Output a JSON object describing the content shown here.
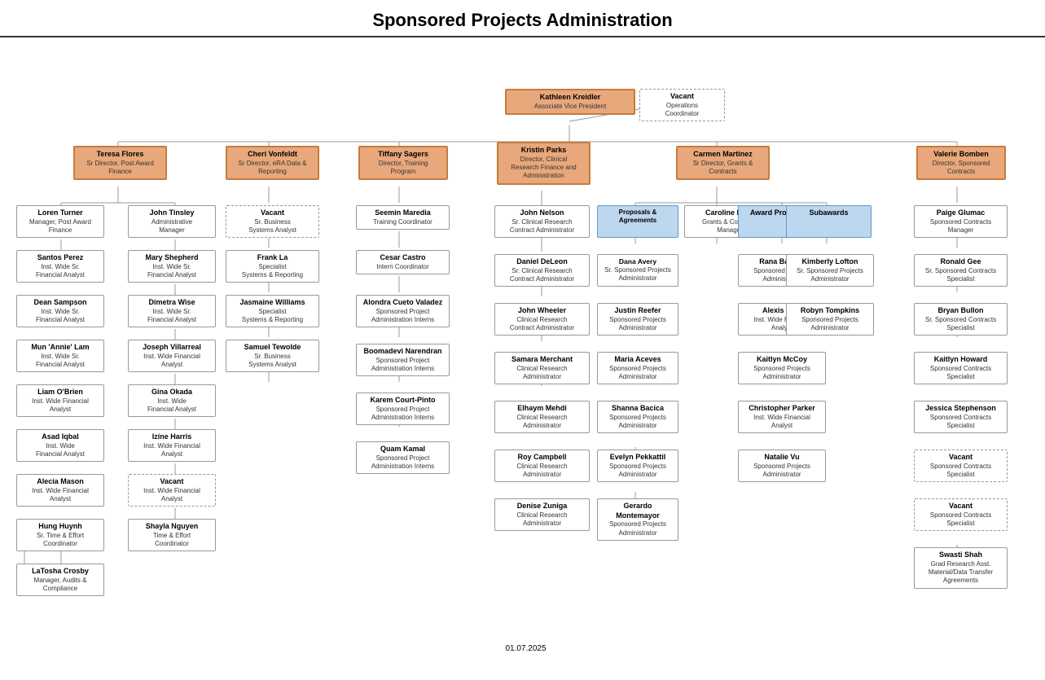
{
  "title": "Sponsored Projects Administration",
  "footer": "01.07.2025",
  "boxes": {
    "kathleen": {
      "name": "Kathleen Kreidler",
      "title": "Associate Vice President"
    },
    "vacant_ops": {
      "name": "Vacant",
      "title": "Operations\nCoordinator"
    },
    "teresa": {
      "name": "Teresa Flores",
      "title": "Sr Director, Post Award\nFinance"
    },
    "cheri": {
      "name": "Cheri Vonfeldt",
      "title": "Sr Director, eRA Data &\nReporting"
    },
    "tiffany": {
      "name": "Tiffany Sagers",
      "title": "Director, Training\nProgram"
    },
    "kristin": {
      "name": "Kristin Parks",
      "title": "Director, Clinical\nResearch Finance and\nAdministration"
    },
    "carmen": {
      "name": "Carmen Martinez",
      "title": "Sr Director, Grants &\nContracts"
    },
    "valerie": {
      "name": "Valerie Bomben",
      "title": "Director, Sponsored\nContracts"
    },
    "loren": {
      "name": "Loren Turner",
      "title": "Manager, Post Award\nFinance"
    },
    "john_t": {
      "name": "John Tinsley",
      "title": "Administrative\nManager"
    },
    "vacant_sr": {
      "name": "Vacant",
      "title": "Sr. Business\nSystems Analyst"
    },
    "frank": {
      "name": "Frank La",
      "title": "Specialist\nSystems & Reporting"
    },
    "jasmaine": {
      "name": "Jasmaine Williams",
      "title": "Specialist\nSystems & Reporting"
    },
    "samuel": {
      "name": "Samuel Tewolde",
      "title": "Sr. Business\nSystems Analyst"
    },
    "seemin": {
      "name": "Seemin Maredia",
      "title": "Training Coordinator"
    },
    "cesar": {
      "name": "Cesar Castro",
      "title": "Intern Coordinator"
    },
    "alondra": {
      "name": "Alondra Cueto Valadez",
      "title": "Sponsored Project\nAdministration Interns"
    },
    "boomadevi": {
      "name": "Boomadevi Narendran",
      "title": "Sponsored Project\nAdministration Interns"
    },
    "karem": {
      "name": "Karem Court-Pinto",
      "title": "Sponsored Project\nAdministration Interns"
    },
    "quam": {
      "name": "Quam Kamal",
      "title": "Sponsored Project\nAdministration Interns"
    },
    "john_n": {
      "name": "John Nelson",
      "title": "Sr. Clinical Research\nContract Administrator"
    },
    "daniel": {
      "name": "Daniel DeLeon",
      "title": "Sr. Clinical Research\nContract Administrator"
    },
    "john_w": {
      "name": "John Wheeler",
      "title": "Clinical Research\nContract Administrator"
    },
    "samara": {
      "name": "Samara Merchant",
      "title": "Clinical Research\nAdministrator"
    },
    "elhaym": {
      "name": "Elhaym Mehdi",
      "title": "Clinical Research\nAdministrator"
    },
    "roy": {
      "name": "Roy Campbell",
      "title": "Clinical Research\nAdministrator"
    },
    "denise": {
      "name": "Denise Zuniga",
      "title": "Clinical Research\nAdministrator"
    },
    "proposals": {
      "name": "Proposals &\nAgreements",
      "title": ""
    },
    "award_processing": {
      "name": "Award Processing",
      "title": ""
    },
    "subawards": {
      "name": "Subawards",
      "title": ""
    },
    "caroline": {
      "name": "Caroline Dietz",
      "title": "Grants & Contracts\nManager"
    },
    "dana_avery": {
      "name": "Dana Avery",
      "title": "Sr. Sponsored Projects\nAdministrator"
    },
    "justin": {
      "name": "Justin Reefer",
      "title": "Sponsored Projects\nAdministrator"
    },
    "maria": {
      "name": "Maria Aceves",
      "title": "Sponsored Projects\nAdministrator"
    },
    "shanna": {
      "name": "Shanna Bacica",
      "title": "Sponsored Projects\nAdministrator"
    },
    "evelyn_p": {
      "name": "Evelyn Pekkattil",
      "title": "Sponsored Projects\nAdministrator"
    },
    "gerardo": {
      "name": "Gerardo Montemayor",
      "title": "Sponsored Projects\nAdministrator"
    },
    "dana_spa": {
      "name": "Dana",
      "title": "Sponsored Projects\nAdministrator"
    },
    "rana": {
      "name": "Rana Banton",
      "title": "Sponsored Projects\nAdministrator"
    },
    "alexis": {
      "name": "Alexis Vara",
      "title": "Inst. Wide Financial\nAnalyst"
    },
    "kaitlyn_m": {
      "name": "Kaitlyn McCoy",
      "title": "Sponsored Projects\nAdministrator"
    },
    "christopher": {
      "name": "Christopher Parker",
      "title": "Inst. Wide Financial\nAnalyst"
    },
    "natalie": {
      "name": "Natalie Vu",
      "title": "Sponsored Projects\nAdministrator"
    },
    "kimberly": {
      "name": "Kimberly Lofton",
      "title": "Sr. Sponsored Projects\nAdministrator"
    },
    "robyn": {
      "name": "Robyn Tompkins",
      "title": "Sponsored Projects\nAdministrator"
    },
    "evelyn_spa": {
      "name": "Evelyn",
      "title": "Sponsored Projects\nAdministrator"
    },
    "paige": {
      "name": "Paige Glumac",
      "title": "Sponsored Contracts\nManager"
    },
    "ronald": {
      "name": "Ronald Gee",
      "title": "Sr. Sponsored Contracts\nSpecialist"
    },
    "bryan": {
      "name": "Bryan Bullon",
      "title": "Sr. Sponsored Contracts\nSpecialist"
    },
    "kaitlyn_h": {
      "name": "Kaitlyn Howard",
      "title": "Sponsored Contracts\nSpecialist"
    },
    "jessica": {
      "name": "Jessica Stephenson",
      "title": "Sponsored Contracts\nSpecialist"
    },
    "vacant_scs1": {
      "name": "Vacant",
      "title": "Sponsored Contracts\nSpecialist"
    },
    "vacant_scs2": {
      "name": "Vacant",
      "title": "Sponsored Contracts\nSpecialist"
    },
    "swasti": {
      "name": "Swasti Shah",
      "title": "Grad Research Asst.\nMaterial/Data Transfer\nAgreements"
    },
    "santos": {
      "name": "Santos Perez",
      "title": "Inst. Wide Sr.\nFinancial Analyst"
    },
    "mary": {
      "name": "Mary Shepherd",
      "title": "Inst. Wide Sr.\nFinancial Analyst"
    },
    "dean": {
      "name": "Dean Sampson",
      "title": "Inst. Wide Sr.\nFinancial Analyst"
    },
    "dimetra": {
      "name": "Dimetra Wise",
      "title": "Inst. Wide Sr.\nFinancial Analyst"
    },
    "annie": {
      "name": "Mun 'Annie' Lam",
      "title": "Inst. Wide Sr.\nFinancial Analyst"
    },
    "joseph": {
      "name": "Joseph Villarreal",
      "title": "Inst. Wide Financial\nAnalyst"
    },
    "liam": {
      "name": "Liam O'Brien",
      "title": "Inst. Wide Financial\nAnalyst"
    },
    "gina": {
      "name": "Gina Okada",
      "title": "Inst. Wide\nFinancial Analyst"
    },
    "asad": {
      "name": "Asad Iqbal",
      "title": "Inst. Wide\nFinancial Analyst"
    },
    "izine": {
      "name": "Izine Harris",
      "title": "Inst. Wide Financial\nAnalyst"
    },
    "alecia": {
      "name": "Alecia Mason",
      "title": "Inst. Wide Financial\nAnalyst"
    },
    "vacant_fa": {
      "name": "Vacant",
      "title": "Inst. Wide Financial\nAnalyst"
    },
    "hung": {
      "name": "Hung Huynh",
      "title": "Sr. Time & Effort\nCoordinator"
    },
    "shayla": {
      "name": "Shayla Nguyen",
      "title": "Time & Effort\nCoordinator"
    },
    "latosha": {
      "name": "LaTosha Crosby",
      "title": "Manager, Audits &\nCompliance"
    }
  }
}
